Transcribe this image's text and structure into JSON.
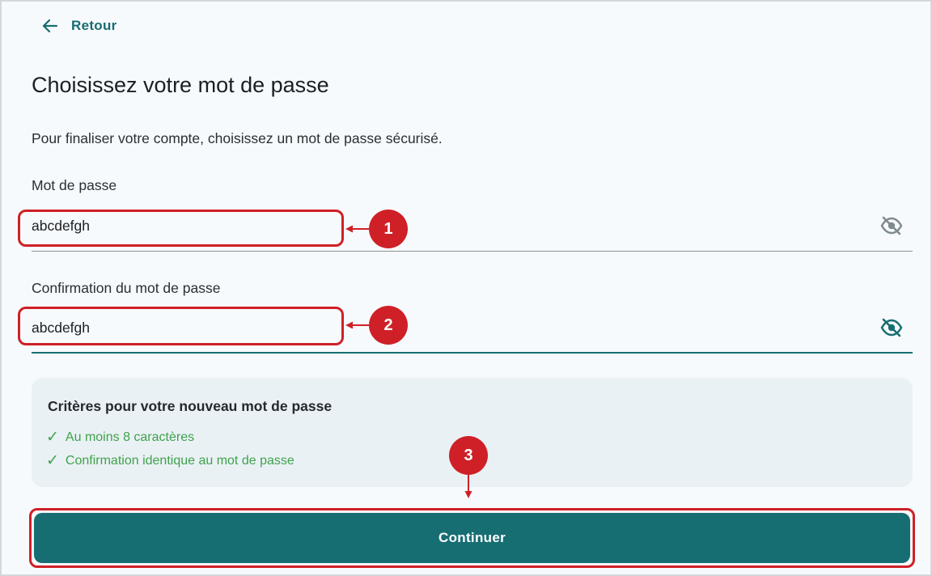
{
  "header": {
    "back_label": "Retour"
  },
  "page": {
    "title": "Choisissez votre mot de passe",
    "intro": "Pour finaliser votre compte, choisissez un mot de passe sécurisé."
  },
  "form": {
    "password": {
      "label": "Mot de passe",
      "value": "abcdefgh",
      "toggle_icon": "eye-off-icon"
    },
    "confirm": {
      "label": "Confirmation du mot de passe",
      "value": "abcdefgh",
      "toggle_icon": "eye-off-icon"
    }
  },
  "criteria": {
    "title": "Critères pour votre nouveau mot de passe",
    "items": [
      {
        "label": "Au moins 8 caractères",
        "met": true
      },
      {
        "label": "Confirmation identique au mot de passe",
        "met": true
      }
    ]
  },
  "actions": {
    "continue_label": "Continuer"
  },
  "annotations": {
    "steps": [
      "1",
      "2",
      "3"
    ]
  },
  "colors": {
    "accent": "#166e73",
    "success": "#3fa24b",
    "annotation": "#cf2027",
    "panel": "#eaf1f5"
  }
}
